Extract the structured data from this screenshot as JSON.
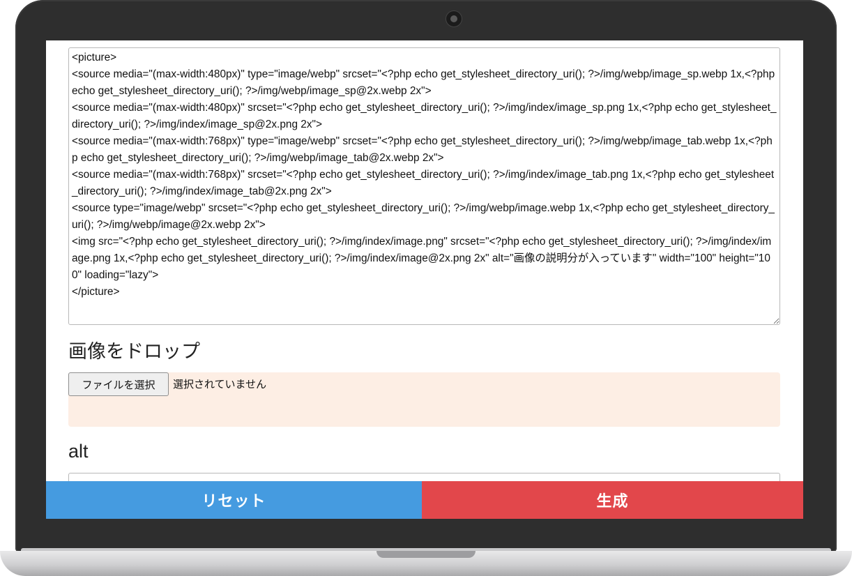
{
  "editor": {
    "code": "<picture>\n<source media=\"(max-width:480px)\" type=\"image/webp\" srcset=\"<?php echo get_stylesheet_directory_uri(); ?>/img/webp/image_sp.webp 1x,<?php echo get_stylesheet_directory_uri(); ?>/img/webp/image_sp@2x.webp 2x\">\n<source media=\"(max-width:480px)\" srcset=\"<?php echo get_stylesheet_directory_uri(); ?>/img/index/image_sp.png 1x,<?php echo get_stylesheet_directory_uri(); ?>/img/index/image_sp@2x.png 2x\">\n<source media=\"(max-width:768px)\" type=\"image/webp\" srcset=\"<?php echo get_stylesheet_directory_uri(); ?>/img/webp/image_tab.webp 1x,<?php echo get_stylesheet_directory_uri(); ?>/img/webp/image_tab@2x.webp 2x\">\n<source media=\"(max-width:768px)\" srcset=\"<?php echo get_stylesheet_directory_uri(); ?>/img/index/image_tab.png 1x,<?php echo get_stylesheet_directory_uri(); ?>/img/index/image_tab@2x.png 2x\">\n<source type=\"image/webp\" srcset=\"<?php echo get_stylesheet_directory_uri(); ?>/img/webp/image.webp 1x,<?php echo get_stylesheet_directory_uri(); ?>/img/webp/image@2x.webp 2x\">\n<img src=\"<?php echo get_stylesheet_directory_uri(); ?>/img/index/image.png\" srcset=\"<?php echo get_stylesheet_directory_uri(); ?>/img/index/image.png 1x,<?php echo get_stylesheet_directory_uri(); ?>/img/index/image@2x.png 2x\" alt=\"画像の説明分が入っています\" width=\"100\" height=\"100\" loading=\"lazy\">\n</picture>"
  },
  "drop": {
    "heading": "画像をドロップ",
    "file_button_label": "ファイルを選択",
    "file_status": "選択されていません"
  },
  "alt": {
    "heading": "alt",
    "value": ""
  },
  "actions": {
    "reset_label": "リセット",
    "generate_label": "生成"
  },
  "colors": {
    "reset": "#459be0",
    "generate": "#e2474b",
    "drop_zone": "#fdeee4",
    "bezel": "#2e2e2e"
  }
}
